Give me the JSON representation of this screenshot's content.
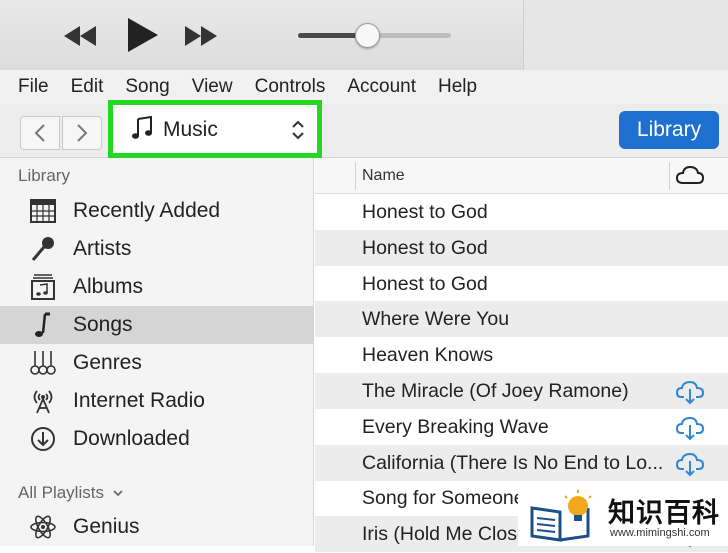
{
  "menu": [
    "File",
    "Edit",
    "Song",
    "View",
    "Controls",
    "Account",
    "Help"
  ],
  "player": {
    "volume_fraction": 0.43
  },
  "toolbar": {
    "media_label": "Music",
    "library_label": "Library"
  },
  "sidebar": {
    "library_heading": "Library",
    "items": [
      {
        "label": "Recently Added",
        "icon": "calendar-grid-icon"
      },
      {
        "label": "Artists",
        "icon": "microphone-icon"
      },
      {
        "label": "Albums",
        "icon": "album-icon"
      },
      {
        "label": "Songs",
        "icon": "music-note-icon",
        "selected": true
      },
      {
        "label": "Genres",
        "icon": "guitars-icon"
      },
      {
        "label": "Internet Radio",
        "icon": "radio-antenna-icon"
      },
      {
        "label": "Downloaded",
        "icon": "download-circle-icon"
      }
    ],
    "playlists_heading": "All Playlists",
    "playlists": [
      {
        "label": "Genius",
        "icon": "atom-icon"
      }
    ]
  },
  "songlist": {
    "column_name": "Name",
    "cloud_icon": "cloud-icon",
    "rows": [
      {
        "name": "Honest to God",
        "download": false
      },
      {
        "name": "Honest to God",
        "download": false
      },
      {
        "name": "Honest to God",
        "download": false
      },
      {
        "name": "Where Were You",
        "download": false
      },
      {
        "name": "Heaven Knows",
        "download": false
      },
      {
        "name": "The Miracle (Of Joey Ramone)",
        "download": true
      },
      {
        "name": "Every Breaking Wave",
        "download": true
      },
      {
        "name": "California (There Is No End to Lo...",
        "download": true
      },
      {
        "name": "Song for Someone",
        "download": true
      },
      {
        "name": "Iris (Hold Me Close)",
        "download": true
      }
    ]
  },
  "watermark": {
    "title": "知识百科",
    "url": "www.mimingshi.com"
  },
  "colors": {
    "accent": "#1d6fd0",
    "highlight": "#23d722",
    "download": "#2f86d6"
  }
}
